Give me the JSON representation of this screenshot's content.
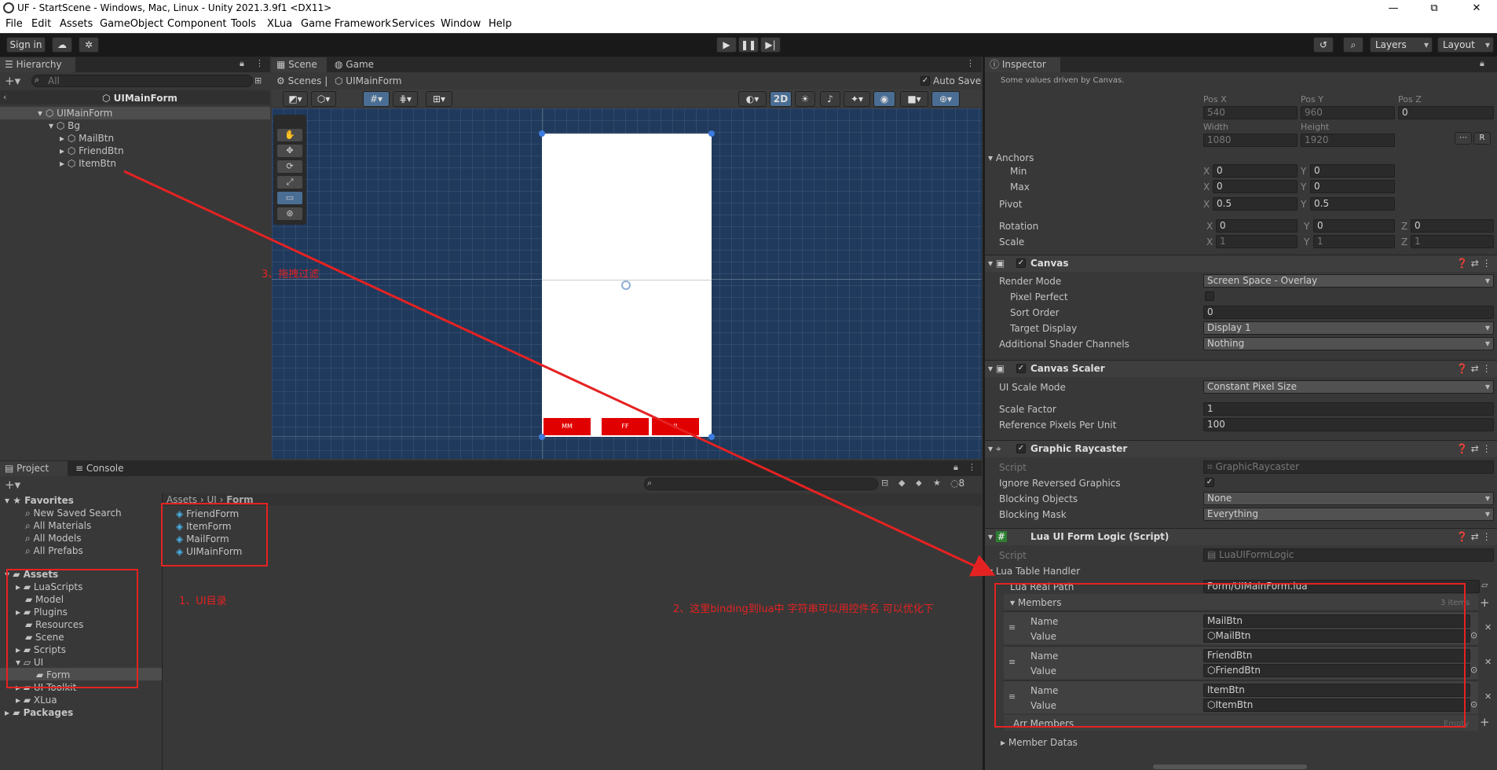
{
  "window": {
    "title": "UF - StartScene - Windows, Mac, Linux - Unity 2021.3.9f1 <DX11>",
    "minimize": "—",
    "maximize": "⧉",
    "close": "✕"
  },
  "menu": [
    "File",
    "Edit",
    "Assets",
    "GameObject",
    "Component",
    "Tools",
    "XLua",
    "Game Framework",
    "Services",
    "Window",
    "Help"
  ],
  "toolbar": {
    "sign_in": "Sign in",
    "layers": "Layers",
    "layout": "Layout"
  },
  "hierarchy": {
    "tab": "Hierarchy",
    "search_placeholder": "All",
    "scene": "UIMainForm",
    "items": [
      "UIMainForm",
      "Bg",
      "MailBtn",
      "FriendBtn",
      "ItemBtn"
    ]
  },
  "scene_view": {
    "tabs": [
      "Scene",
      "Game"
    ],
    "crumb_scenes": "Scenes",
    "crumb_object": "UIMainForm",
    "auto_save": "Auto Save",
    "mode_2d": "2D",
    "buttons": [
      "MM",
      "FF",
      "II"
    ]
  },
  "project": {
    "tabs": [
      "Project",
      "Console"
    ],
    "hidden_count": "8",
    "favorites": "Favorites",
    "fav_items": [
      "New Saved Search",
      "All Materials",
      "All Models",
      "All Prefabs"
    ],
    "assets": "Assets",
    "asset_folders": [
      "LuaScripts",
      "Model",
      "Plugins",
      "Resources",
      "Scene",
      "Scripts",
      "UI",
      "Form",
      "UI Toolkit",
      "XLua"
    ],
    "packages": "Packages",
    "breadcrumb": [
      "Assets",
      "UI",
      "Form"
    ],
    "files": [
      "FriendForm",
      "ItemForm",
      "MailForm",
      "UIMainForm"
    ]
  },
  "inspector": {
    "tab": "Inspector",
    "notice": "Some values driven by Canvas.",
    "pos_labels": [
      "Pos X",
      "Pos Y",
      "Pos Z"
    ],
    "pos_values": [
      "540",
      "960",
      "0"
    ],
    "size_labels": [
      "Width",
      "Height"
    ],
    "size_values": [
      "1080",
      "1920"
    ],
    "anchors": "Anchors",
    "min": "Min",
    "max": "Max",
    "pivot": "Pivot",
    "axis_x": "X",
    "axis_y": "Y",
    "axis_z": "Z",
    "anchor_min": [
      "0",
      "0"
    ],
    "anchor_max": [
      "0",
      "0"
    ],
    "pivot_values": [
      "0.5",
      "0.5"
    ],
    "rotation": "Rotation",
    "rotation_values": [
      "0",
      "0",
      "0"
    ],
    "scale": "Scale",
    "scale_values": [
      "1",
      "1",
      "1"
    ],
    "raw_edit": "R",
    "canvas": {
      "title": "Canvas",
      "render_mode_label": "Render Mode",
      "render_mode": "Screen Space - Overlay",
      "pixel_perfect": "Pixel Perfect",
      "sort_order_label": "Sort Order",
      "sort_order": "0",
      "target_display_label": "Target Display",
      "target_display": "Display 1",
      "shader_channels_label": "Additional Shader Channels",
      "shader_channels": "Nothing"
    },
    "scaler": {
      "title": "Canvas Scaler",
      "scale_mode_label": "UI Scale Mode",
      "scale_mode": "Constant Pixel Size",
      "scale_factor_label": "Scale Factor",
      "scale_factor": "1",
      "ref_ppu_label": "Reference Pixels Per Unit",
      "ref_ppu": "100"
    },
    "raycaster": {
      "title": "Graphic Raycaster",
      "script_label": "Script",
      "script": "GraphicRaycaster",
      "ignore_reversed": "Ignore Reversed Graphics",
      "blocking_objects_label": "Blocking Objects",
      "blocking_objects": "None",
      "blocking_mask_label": "Blocking Mask",
      "blocking_mask": "Everything"
    },
    "lua": {
      "title": "Lua UI Form Logic (Script)",
      "script_label": "Script",
      "script": "LuaUIFormLogic",
      "handler": "Lua Table Handler",
      "real_path_label": "Lua Real Path",
      "real_path": "Form/UIMainForm.lua",
      "members": "Members",
      "members_count": "3 items",
      "name_label": "Name",
      "value_label": "Value",
      "member_list": [
        {
          "name": "MailBtn",
          "value": "MailBtn"
        },
        {
          "name": "FriendBtn",
          "value": "FriendBtn"
        },
        {
          "name": "ItemBtn",
          "value": "ItemBtn"
        }
      ],
      "arr_members": "Arr Members",
      "arr_empty": "Empty",
      "member_datas": "Member Datas"
    }
  },
  "annotations": {
    "a1": "1、UI目录",
    "a2": "2、这里binding到lua中  字符串可以用控件名 可以优化下",
    "a3": "3、拖拽过滤"
  },
  "colors": {
    "accent_red": "#e52222",
    "scene_bg": "#1f3a5c",
    "selection": "#2c5d87"
  }
}
